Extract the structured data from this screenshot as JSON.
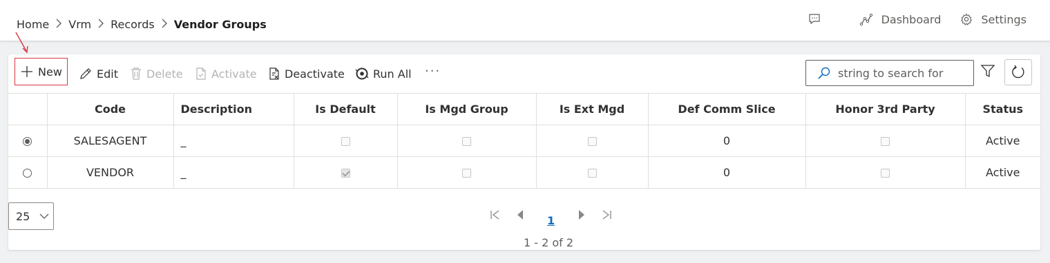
{
  "breadcrumb": [
    "Home",
    "Vrm",
    "Records",
    "Vendor Groups"
  ],
  "header": {
    "dashboard_label": "Dashboard",
    "settings_label": "Settings"
  },
  "toolbar": {
    "new_label": "New",
    "edit_label": "Edit",
    "delete_label": "Delete",
    "activate_label": "Activate",
    "deactivate_label": "Deactivate",
    "run_all_label": "Run All",
    "more_label": "···"
  },
  "search": {
    "placeholder": "string to search for"
  },
  "table": {
    "columns": [
      "",
      "Code",
      "Description",
      "Is Default",
      "Is Mgd Group",
      "Is Ext Mgd",
      "Def Comm Slice",
      "Honor 3rd Party",
      "Status"
    ],
    "rows": [
      {
        "selected": true,
        "code": "SALESAGENT",
        "description": "_",
        "is_default": false,
        "is_mgd_group": false,
        "is_ext_mgd": false,
        "def_comm_slice": "0",
        "honor_3rd_party": false,
        "status": "Active"
      },
      {
        "selected": false,
        "code": "VENDOR",
        "description": "_",
        "is_default": true,
        "is_mgd_group": false,
        "is_ext_mgd": false,
        "def_comm_slice": "0",
        "honor_3rd_party": false,
        "status": "Active"
      }
    ]
  },
  "pagination": {
    "page_size": "25",
    "current_page": "1",
    "info": "1 - 2 of 2"
  },
  "colors": {
    "accent": "#0f6cbd",
    "annotation": "#d9363e"
  }
}
